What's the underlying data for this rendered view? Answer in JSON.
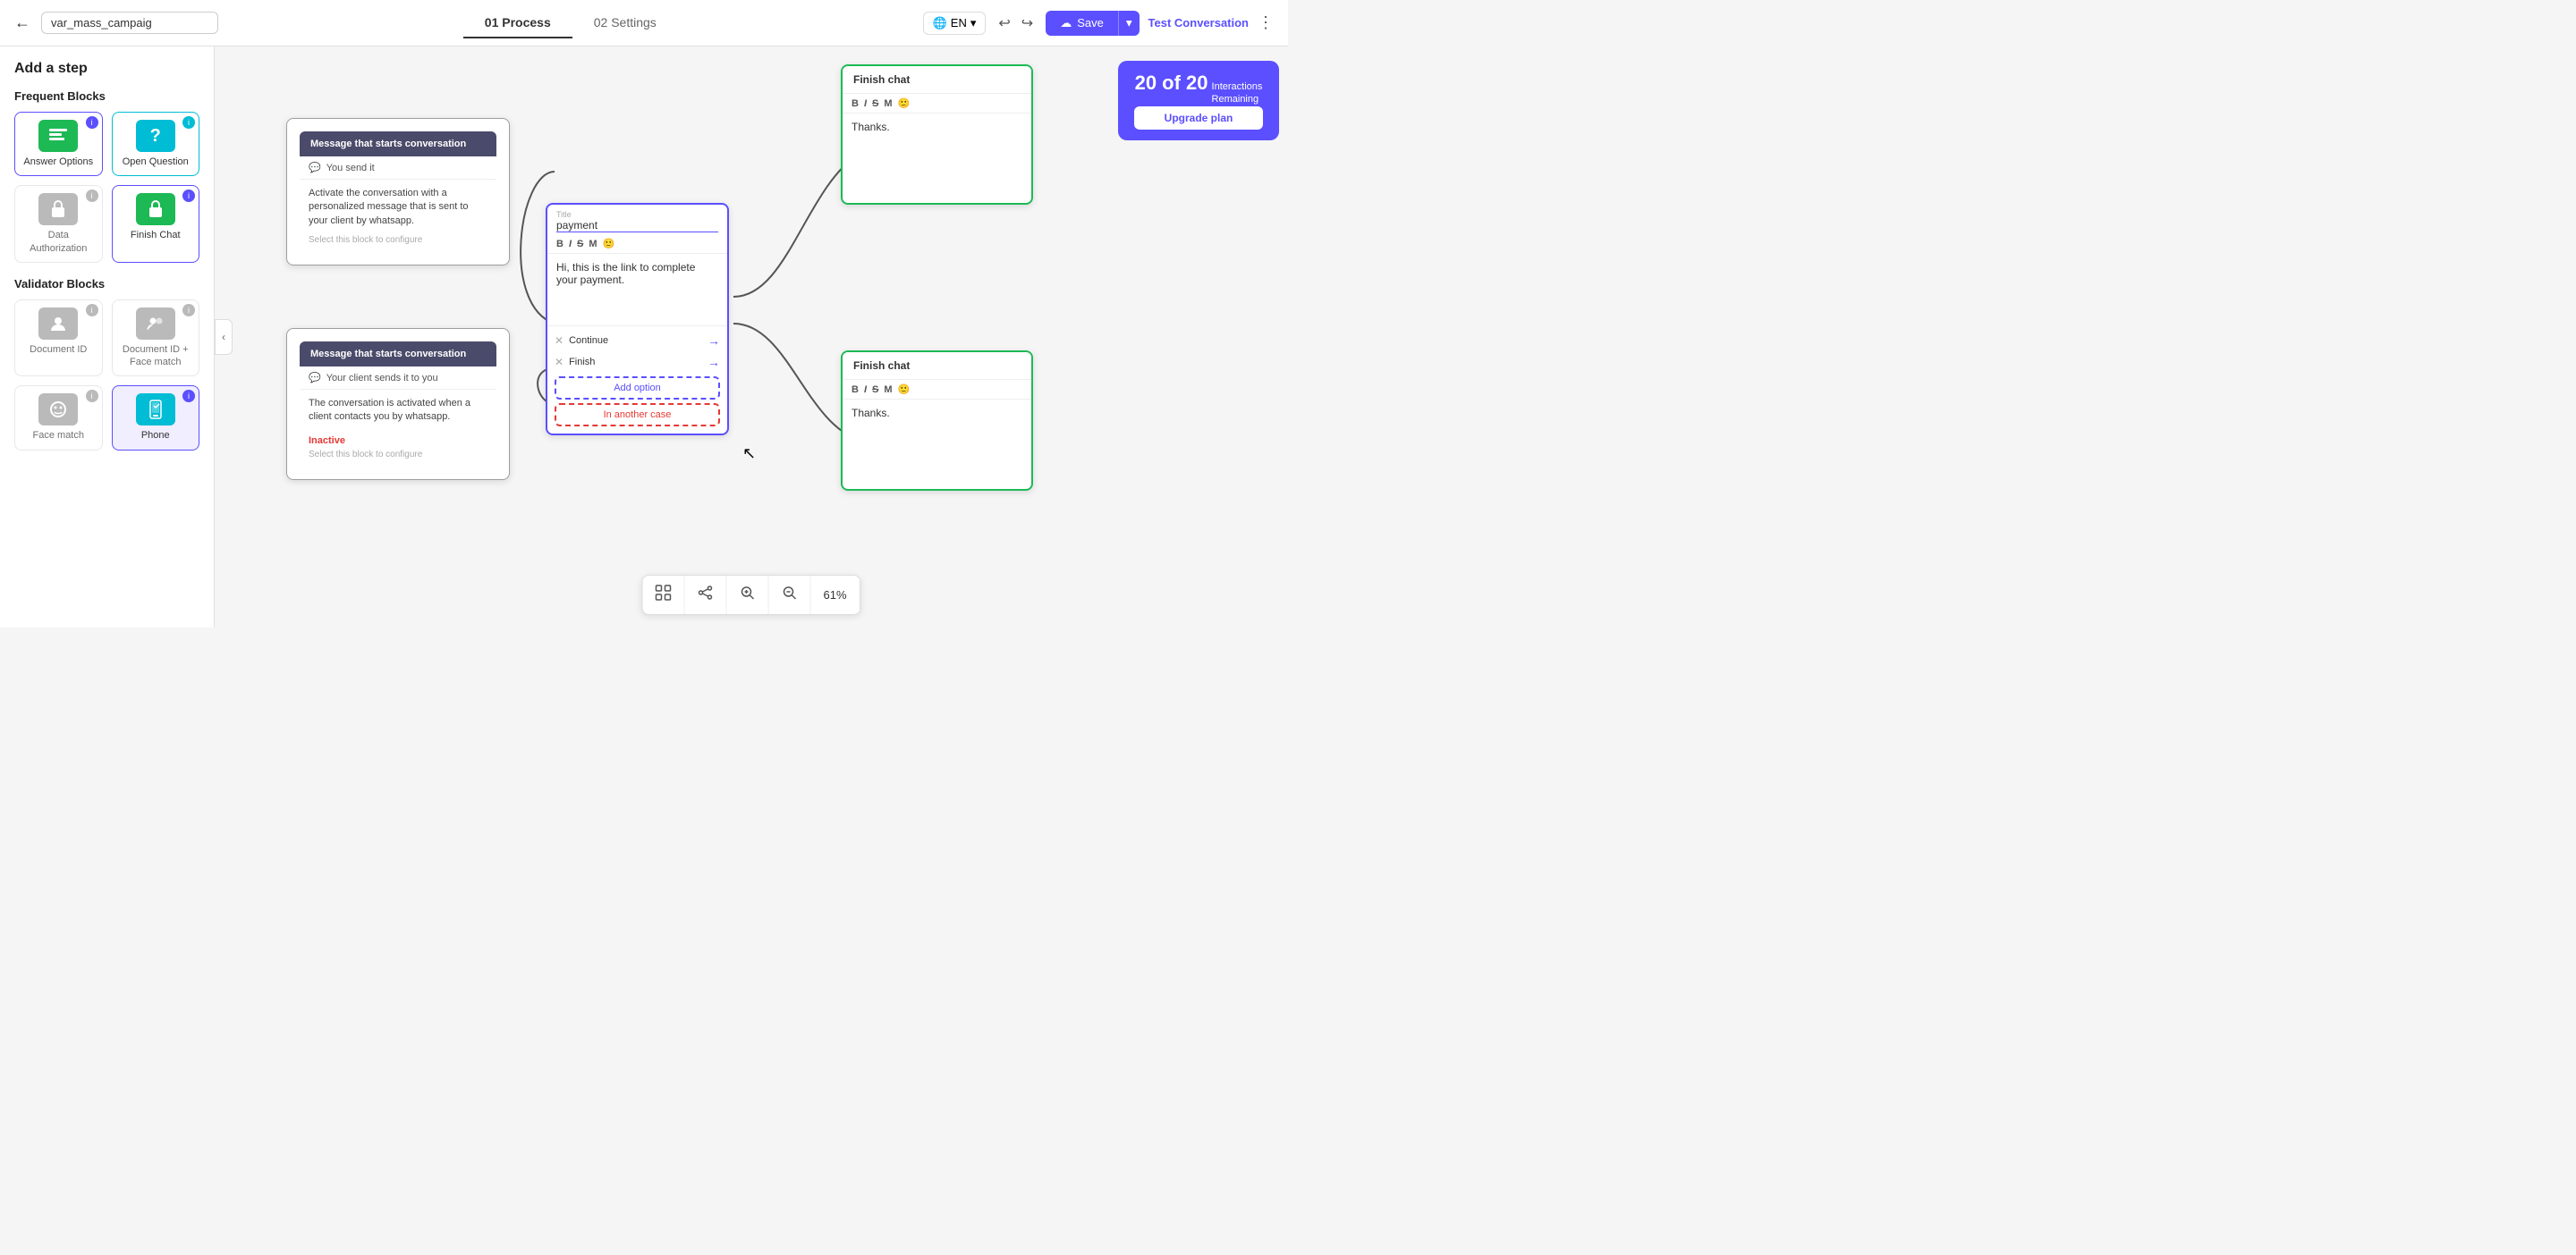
{
  "header": {
    "back_label": "←",
    "project_name": "var_mass_campaig",
    "tab_process": "01 Process",
    "tab_settings": "02 Settings",
    "lang": "EN",
    "undo_icon": "↩",
    "redo_icon": "↪",
    "save_label": "Save",
    "test_label": "Test Conversation",
    "more_icon": "⋮"
  },
  "sidebar": {
    "title": "Add a step",
    "frequent_blocks_title": "Frequent Blocks",
    "blocks": [
      {
        "id": "answer-options",
        "label": "Answer Options",
        "icon": "☰",
        "color": "green",
        "info": "i"
      },
      {
        "id": "open-question",
        "label": "Open Question",
        "icon": "?",
        "color": "teal",
        "info": "i"
      },
      {
        "id": "data-authorization",
        "label": "Data Authorization",
        "icon": "🔒",
        "color": "gray",
        "info": "i",
        "disabled": true
      },
      {
        "id": "finish-chat",
        "label": "Finish Chat",
        "icon": "✓",
        "color": "green",
        "info": "i"
      }
    ],
    "validator_blocks_title": "Validator Blocks",
    "validator_blocks": [
      {
        "id": "document-id",
        "label": "Document ID",
        "icon": "👤",
        "color": "gray",
        "info": "i"
      },
      {
        "id": "document-id-face",
        "label": "Document ID + Face match",
        "icon": "👤",
        "color": "gray",
        "info": "i"
      },
      {
        "id": "face-match",
        "label": "Face match",
        "icon": "😊",
        "color": "gray",
        "info": "i"
      },
      {
        "id": "phone",
        "label": "Phone",
        "icon": "📱",
        "color": "teal",
        "info": "i",
        "active": true
      }
    ]
  },
  "canvas": {
    "nodes": {
      "start1": {
        "header": "Message that starts conversation",
        "subheader": "You send it",
        "body": "Activate the conversation with a personalized message that is sent to your client by whatsapp.",
        "configure": "Select this block to configure"
      },
      "start2": {
        "header": "Message that starts conversation",
        "subheader": "Your client sends it to you",
        "body": "The conversation is activated when a client contacts you by whatsapp.",
        "inactive_label": "Inactive",
        "configure": "Select this block to configure"
      },
      "payment": {
        "title_label": "Title",
        "title_value": "payment",
        "content": "Hi, this is the link to complete your payment."
      },
      "finish1": {
        "header": "Finish chat",
        "content": "Thanks."
      },
      "finish2": {
        "header": "Finish chat",
        "content": "Thanks."
      }
    },
    "options": [
      {
        "label": "Continue",
        "type": "continue"
      },
      {
        "label": "Finish",
        "type": "finish"
      }
    ],
    "add_option_label": "Add option",
    "another_case_label": "In another case",
    "zoom_level": "61%"
  },
  "interactions_badge": {
    "count": "20 of 20",
    "label": "Interactions\nRemaining",
    "upgrade_label": "Upgrade plan"
  },
  "toolbar": {
    "focus_icon": "⊞",
    "share_icon": "⊕",
    "zoom_in_icon": "+",
    "zoom_out_icon": "−",
    "zoom_level": "61%"
  }
}
